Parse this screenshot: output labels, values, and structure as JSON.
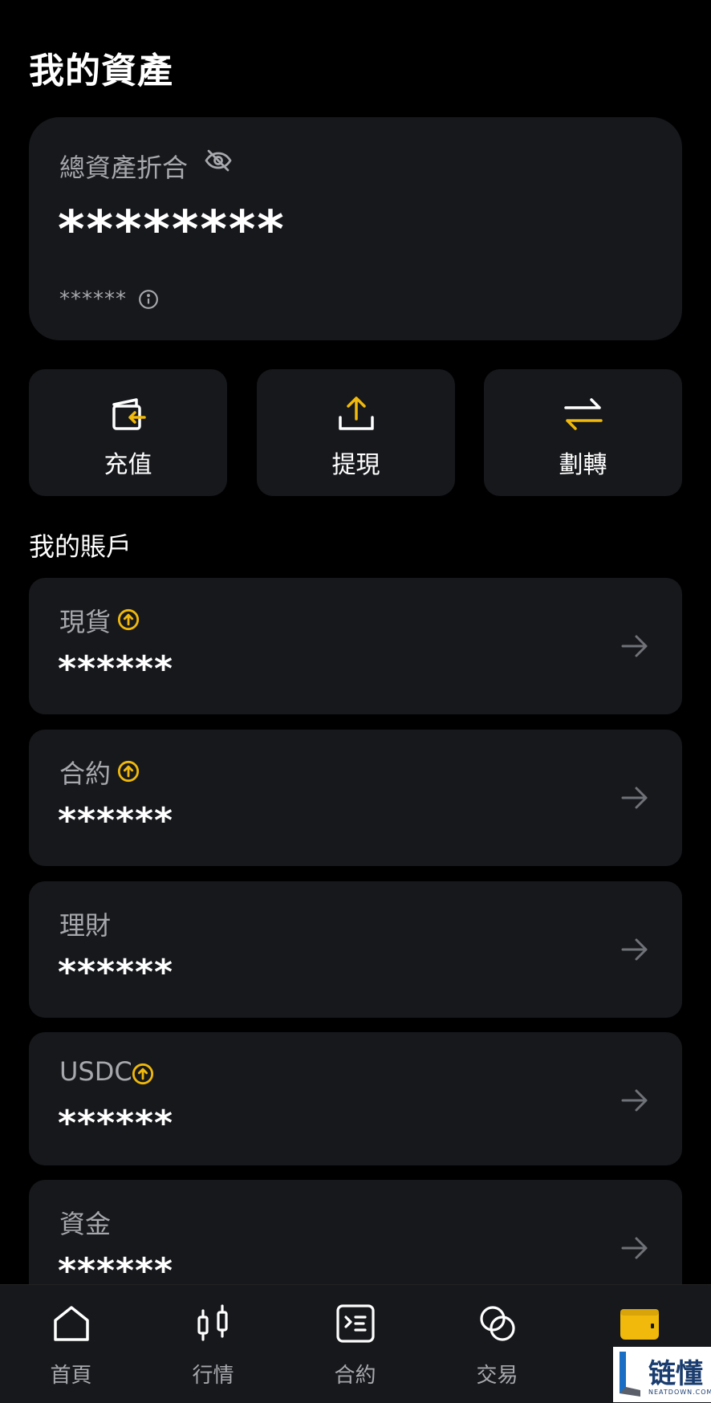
{
  "page": {
    "title": "我的資產"
  },
  "total": {
    "label": "總資產折合",
    "value": "********",
    "sub_value": "******",
    "eye_icon": "eye-off-icon",
    "info_icon": "info-icon"
  },
  "actions": [
    {
      "label": "充值",
      "icon": "deposit-icon"
    },
    {
      "label": "提現",
      "icon": "upload-icon"
    },
    {
      "label": "劃轉",
      "icon": "transfer-icon"
    }
  ],
  "accounts_section": {
    "title": "我的賬戶"
  },
  "accounts": [
    {
      "name": "現貨",
      "value": "******",
      "has_up_icon": true
    },
    {
      "name": "合約",
      "value": "******",
      "has_up_icon": true
    },
    {
      "name": "理財",
      "value": "******",
      "has_up_icon": false
    },
    {
      "name": "USDC",
      "value": "******",
      "has_up_icon": true
    },
    {
      "name": "資金",
      "value": "******",
      "has_up_icon": false
    }
  ],
  "bottom_nav": [
    {
      "label": "首頁",
      "icon": "home-icon"
    },
    {
      "label": "行情",
      "icon": "candlestick-icon"
    },
    {
      "label": "合約",
      "icon": "contract-icon"
    },
    {
      "label": "交易",
      "icon": "trade-icon"
    },
    {
      "label": "",
      "icon": "wallet-icon",
      "active": true
    }
  ],
  "watermark": {
    "text": "链懂",
    "sub": "NEATDOWN.COM"
  },
  "colors": {
    "background": "#000000",
    "card": "#17181c",
    "accent": "#f0b90b",
    "muted": "#a6a8ad"
  }
}
